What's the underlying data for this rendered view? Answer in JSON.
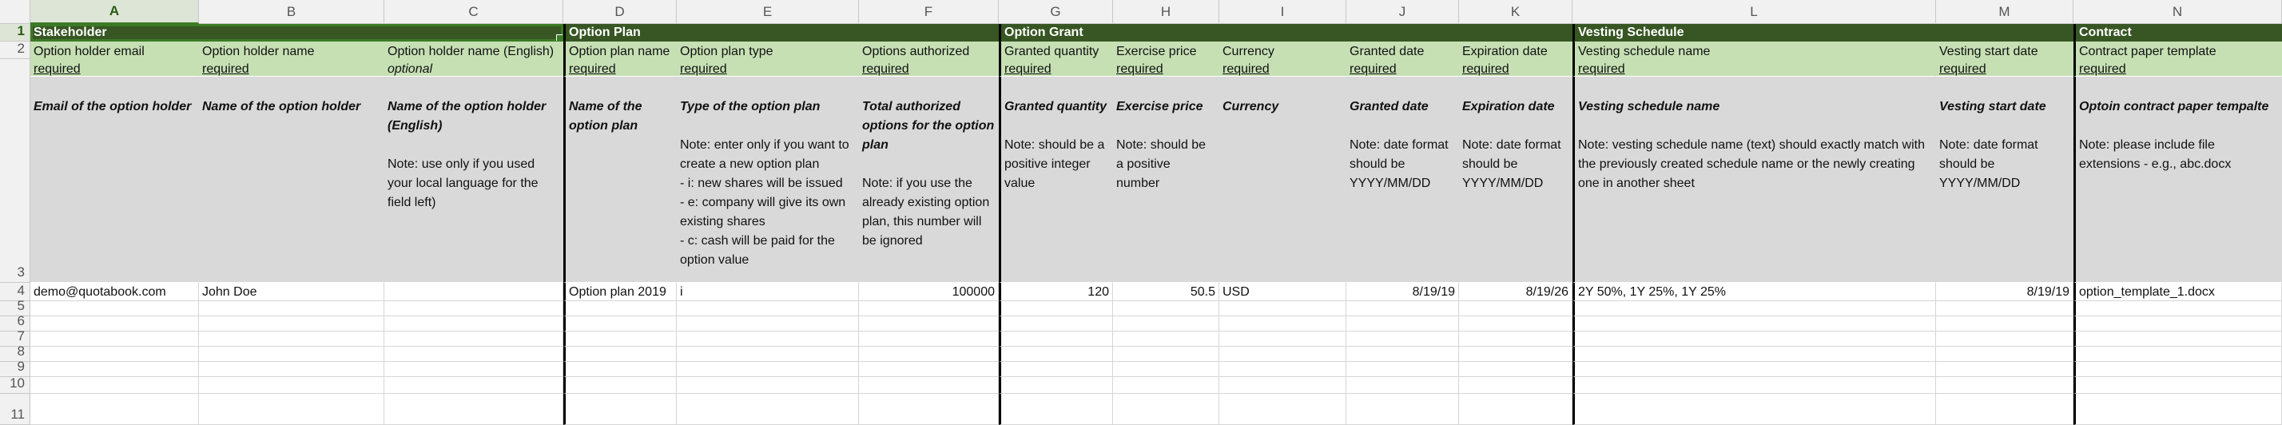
{
  "columns": [
    "A",
    "B",
    "C",
    "D",
    "E",
    "F",
    "G",
    "H",
    "I",
    "J",
    "K",
    "L",
    "M",
    "N"
  ],
  "rows": [
    "1",
    "2",
    "3",
    "4",
    "5",
    "6",
    "7",
    "8",
    "9",
    "10",
    "11"
  ],
  "groups": {
    "stakeholder": "Stakeholder",
    "option_plan": "Option Plan",
    "option_grant": "Option Grant",
    "vesting_schedule": "Vesting Schedule",
    "contract": "Contract"
  },
  "fields": {
    "A": {
      "name": "Option holder email",
      "flag": "required",
      "title": "Email of the option holder",
      "note": ""
    },
    "B": {
      "name": "Option holder name",
      "flag": "required",
      "title": "Name of the option holder",
      "note": ""
    },
    "C": {
      "name": "Option holder name (English)",
      "flag": "optional",
      "title": "Name of the option holder (English)",
      "note": "Note: use only if you used your local language for the field left)"
    },
    "D": {
      "name": "Option plan name",
      "flag": "required",
      "title": "Name of the option plan",
      "note": ""
    },
    "E": {
      "name": "Option plan type",
      "flag": "required",
      "title": "Type of the option plan",
      "note": "Note: enter only if you want to create a new option plan\n- i: new shares will be issued\n- e: company will give its own existing shares\n- c: cash will be paid for the option value"
    },
    "F": {
      "name": "Options authorized",
      "flag": "required",
      "title": "Total authorized options for the option plan",
      "note": "Note: if you use the already existing option plan, this number will be ignored"
    },
    "G": {
      "name": "Granted quantity",
      "flag": "required",
      "title": "Granted quantity",
      "note": "Note: should be a positive integer value"
    },
    "H": {
      "name": "Exercise price",
      "flag": "required",
      "title": "Exercise price",
      "note": "Note: should be a positive number"
    },
    "I": {
      "name": "Currency",
      "flag": "required",
      "title": "Currency",
      "note": ""
    },
    "J": {
      "name": "Granted date",
      "flag": "required",
      "title": "Granted date",
      "note": "Note: date format should be YYYY/MM/DD"
    },
    "K": {
      "name": "Expiration date",
      "flag": "required",
      "title": "Expiration date",
      "note": "Note: date format should be YYYY/MM/DD"
    },
    "L": {
      "name": "Vesting schedule name",
      "flag": "required",
      "title": "Vesting schedule name",
      "note": "Note: vesting schedule name (text) should exactly match with  the previously created schedule name or the newly creating one in another sheet"
    },
    "M": {
      "name": "Vesting start date",
      "flag": "required",
      "title": "Vesting start date",
      "note": "Note: date format should be YYYY/MM/DD"
    },
    "N": {
      "name": "Contract paper template",
      "flag": "required",
      "title": "Optoin contract paper tempalte",
      "note": "Note: please include file extensions - e.g., abc.docx"
    }
  },
  "row4": {
    "A": "demo@quotabook.com",
    "B": "John Doe",
    "C": "",
    "D": "Option plan 2019",
    "E": "i",
    "F": "100000",
    "G": "120",
    "H": "50.5",
    "I": "USD",
    "J": "8/19/19",
    "K": "8/19/26",
    "L": "2Y 50%, 1Y 25%, 1Y 25%",
    "M": "8/19/19",
    "N": "option_template_1.docx"
  },
  "colors": {
    "group_header_bg": "#375623",
    "field_header_bg": "#c6e0b4",
    "description_bg": "#d9d9d9",
    "selection": "#3b7b25"
  },
  "selected_cell": "A1"
}
